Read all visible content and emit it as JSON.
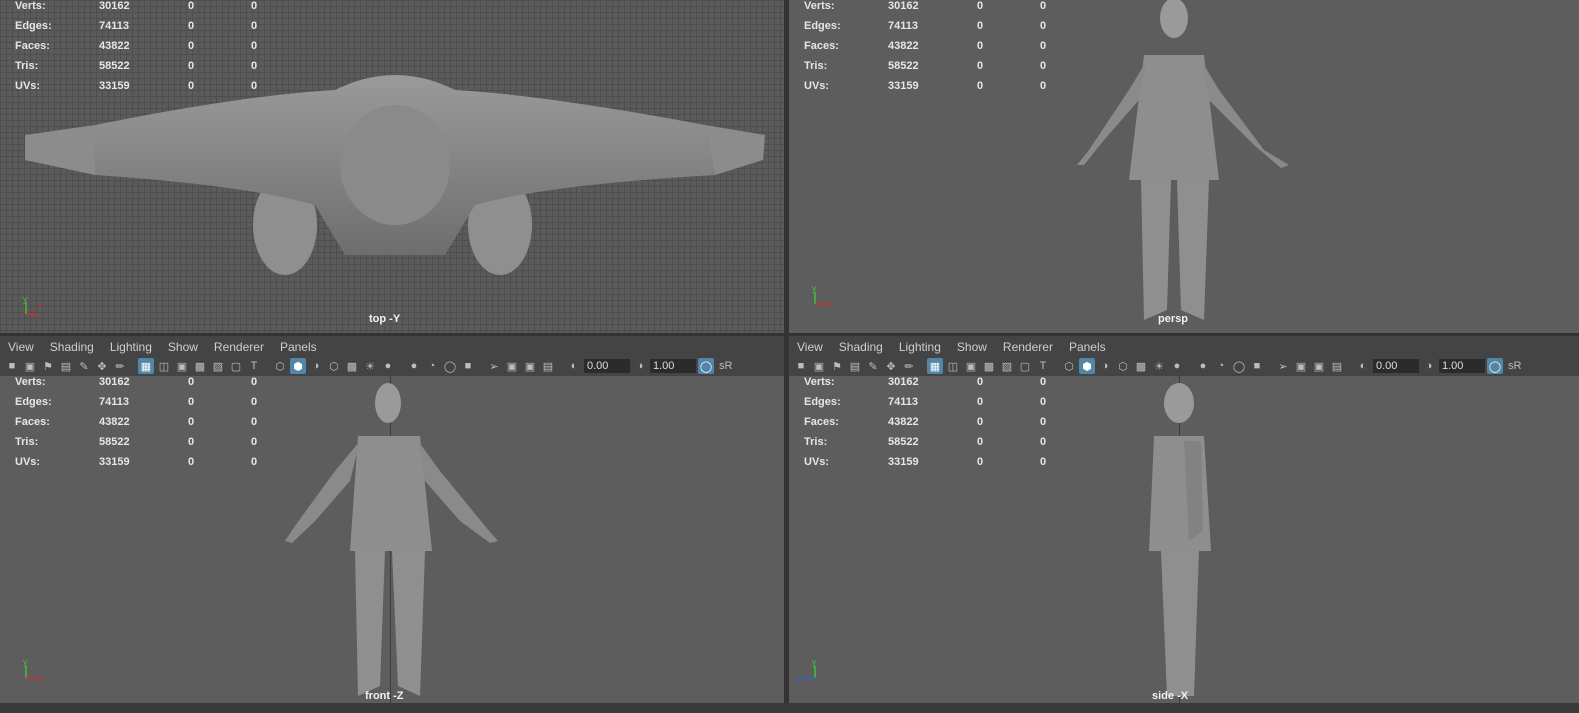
{
  "menus": [
    "View",
    "Shading",
    "Lighting",
    "Show",
    "Renderer",
    "Panels"
  ],
  "hud": [
    {
      "label": "Verts:",
      "values": [
        "30162",
        "0",
        "0"
      ]
    },
    {
      "label": "Edges:",
      "values": [
        "74113",
        "0",
        "0"
      ]
    },
    {
      "label": "Faces:",
      "values": [
        "43822",
        "0",
        "0"
      ]
    },
    {
      "label": "Tris:",
      "values": [
        "58522",
        "0",
        "0"
      ]
    },
    {
      "label": "UVs:",
      "values": [
        "33159",
        "0",
        "0"
      ]
    }
  ],
  "viewports": {
    "top": {
      "camera": "top -Y"
    },
    "persp": {
      "camera": "persp"
    },
    "front": {
      "camera": "front -Z"
    },
    "side": {
      "camera": "side -X"
    }
  },
  "toolbar": {
    "exposure": "0.00",
    "gamma": "1.00",
    "color_space": "sR"
  },
  "axes": {
    "y": "y",
    "x": "x",
    "z": "z"
  },
  "colors": {
    "viewport_bg": "#5d5d5d",
    "active_icon": "#5285a6",
    "axis_x": "#d03030",
    "axis_y": "#40c040",
    "axis_z": "#3060d0"
  }
}
